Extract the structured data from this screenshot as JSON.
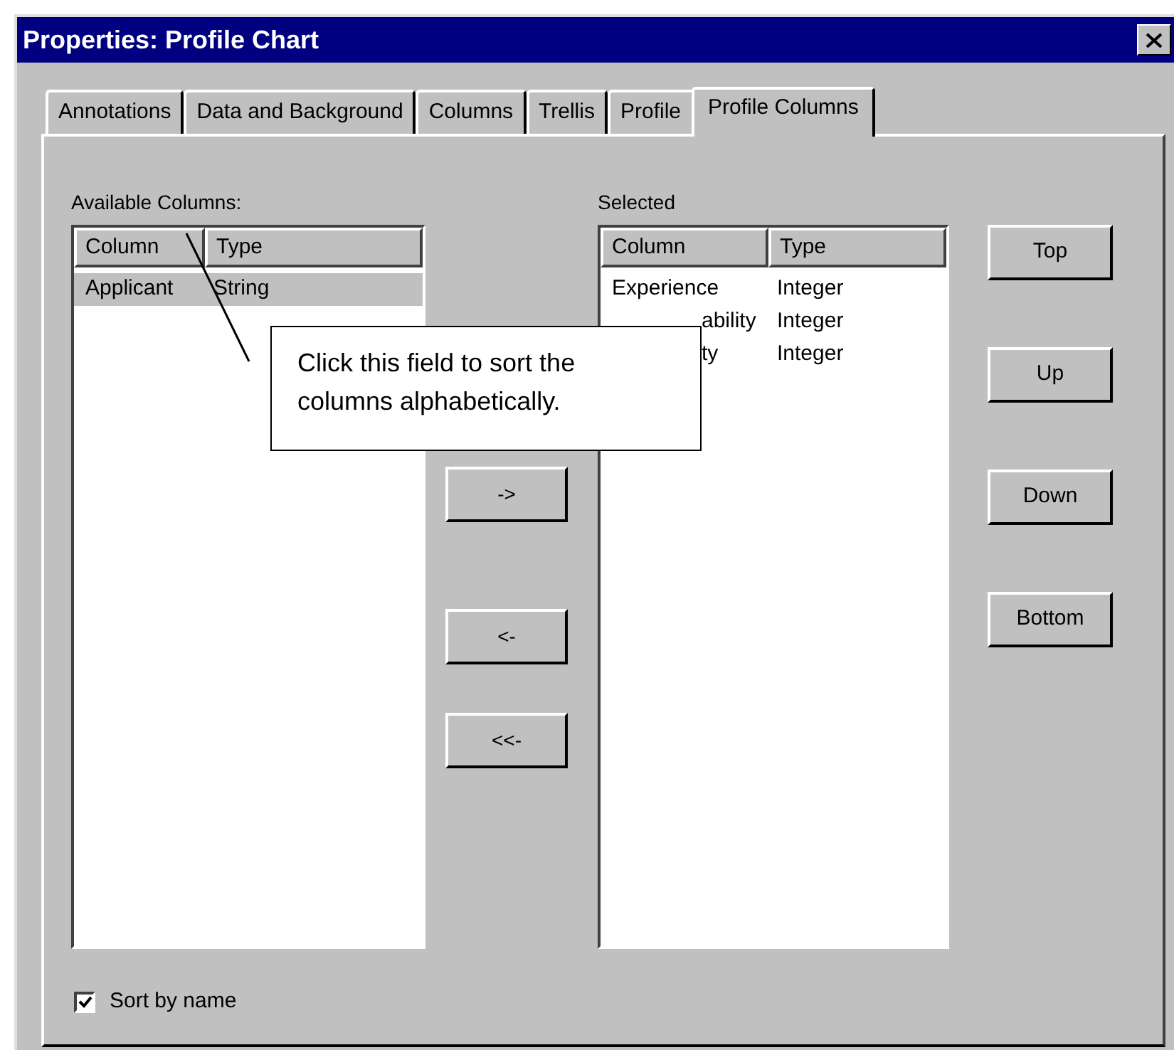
{
  "window": {
    "title": "Properties: Profile Chart"
  },
  "tabs": [
    {
      "label": "Annotations",
      "selected": false
    },
    {
      "label": "Data and Background",
      "selected": false
    },
    {
      "label": "Columns",
      "selected": false
    },
    {
      "label": "Trellis",
      "selected": false
    },
    {
      "label": "Profile",
      "selected": false
    },
    {
      "label": "Profile Columns",
      "selected": true
    }
  ],
  "available": {
    "label": "Available Columns:",
    "columns": [
      "Column",
      "Type"
    ],
    "rows": [
      {
        "cells": [
          "Applicant",
          "String"
        ],
        "selected": true,
        "covered": false
      }
    ]
  },
  "selected_list": {
    "label": "Selected",
    "columns": [
      "Column",
      "Type"
    ],
    "rows": [
      {
        "cells": [
          "Experience",
          "Integer"
        ],
        "selected": false,
        "covered": false
      },
      {
        "cells": [
          "ability",
          "Integer"
        ],
        "selected": false,
        "covered": true
      },
      {
        "cells": [
          "ty",
          "Integer"
        ],
        "selected": false,
        "covered": true
      }
    ]
  },
  "move_buttons": [
    "->",
    "<-",
    "<<-"
  ],
  "order_buttons": [
    "Top",
    "Up",
    "Down",
    "Bottom"
  ],
  "sort_by_name": {
    "label": "Sort by name",
    "checked": true
  },
  "callout": {
    "text": "Click this field to sort the columns alphabetically."
  }
}
